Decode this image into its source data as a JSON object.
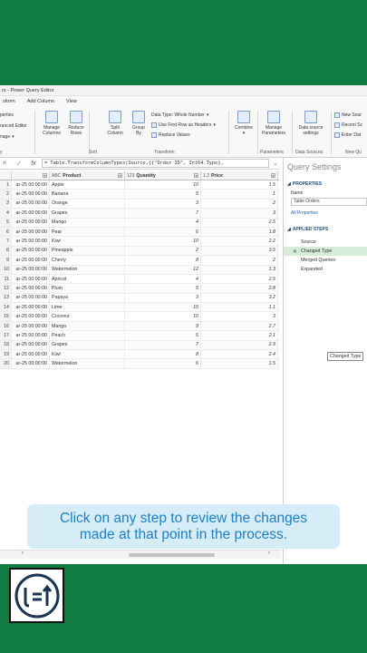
{
  "window": {
    "title": "rs - Power Query Editor"
  },
  "tabs": [
    "sform",
    "Add Column",
    "View"
  ],
  "ribbon": {
    "left_items": [
      "perties",
      "ranced Editor",
      "nage"
    ],
    "manage_columns": [
      "Manage",
      "Columns"
    ],
    "reduce_rows": [
      "Reduce",
      "Rows"
    ],
    "split_column": [
      "Split",
      "Column"
    ],
    "group_by": [
      "Group",
      "By"
    ],
    "data_type": "Data Type: Whole Number",
    "first_row_headers": "Use First Row as Headers",
    "replace_values": "Replace Values",
    "combine": "Combine",
    "manage_parameters": [
      "Manage",
      "Parameters"
    ],
    "data_source_settings": [
      "Data source",
      "settings"
    ],
    "new_source": "New Sour",
    "recent_sources": "Recent Sc",
    "enter_data": "Enter Dat",
    "groups": {
      "sort": "Sort",
      "transform": "Transform",
      "parameters": "Parameters",
      "data_sources": "Data Sources",
      "new_query": "New Qu",
      "left": "y"
    }
  },
  "formula": {
    "text": "= Table.TransformColumnTypes(Source,{{\"Order ID\", Int64.Type},"
  },
  "columns": {
    "product": {
      "type_icon": "ABC",
      "name": "Product"
    },
    "quantity": {
      "type_icon": "123",
      "name": "Quantity"
    },
    "price": {
      "type_icon": "1.2",
      "name": "Price"
    }
  },
  "rows": [
    {
      "n": "1",
      "date": "ar-25 00:00:00",
      "product": "Apple",
      "qty": "10",
      "price": "1.5"
    },
    {
      "n": "2",
      "date": "ar-25 00:00:00",
      "product": "Banana",
      "qty": "5",
      "price": "1"
    },
    {
      "n": "3",
      "date": "ar-25 00:00:00",
      "product": "Orange",
      "qty": "3",
      "price": "2"
    },
    {
      "n": "4",
      "date": "ar-25 00:00:00",
      "product": "Grapes",
      "qty": "7",
      "price": "3"
    },
    {
      "n": "5",
      "date": "ar-25 00:00:00",
      "product": "Mango",
      "qty": "4",
      "price": "2.5"
    },
    {
      "n": "6",
      "date": "ar-25 00:00:00",
      "product": "Pear",
      "qty": "6",
      "price": "1.8"
    },
    {
      "n": "7",
      "date": "ar-25 00:00:00",
      "product": "Kiwi",
      "qty": "10",
      "price": "2.2"
    },
    {
      "n": "8",
      "date": "ar-25 00:00:00",
      "product": "Pineapple",
      "qty": "2",
      "price": "3.5"
    },
    {
      "n": "9",
      "date": "ar-25 00:00:00",
      "product": "Cherry",
      "qty": "8",
      "price": "2"
    },
    {
      "n": "10",
      "date": "ar-25 00:00:00",
      "product": "Watermelon",
      "qty": "12",
      "price": "1.3"
    },
    {
      "n": "11",
      "date": "ar-25 00:00:00",
      "product": "Apricot",
      "qty": "4",
      "price": "2.5"
    },
    {
      "n": "12",
      "date": "ar-25 00:00:00",
      "product": "Plum",
      "qty": "5",
      "price": "2.8"
    },
    {
      "n": "13",
      "date": "ar-25 00:00:00",
      "product": "Papaya",
      "qty": "3",
      "price": "3.2"
    },
    {
      "n": "14",
      "date": "ar-25 00:00:00",
      "product": "Lime",
      "qty": "15",
      "price": "1.1"
    },
    {
      "n": "15",
      "date": "ar-25 00:00:00",
      "product": "Coconut",
      "qty": "10",
      "price": "3"
    },
    {
      "n": "16",
      "date": "ar-25 00:00:00",
      "product": "Mango",
      "qty": "9",
      "price": "2.7"
    },
    {
      "n": "17",
      "date": "ar-25 00:00:00",
      "product": "Peach",
      "qty": "5",
      "price": "2.1"
    },
    {
      "n": "18",
      "date": "ar-25 00:00:00",
      "product": "Grapes",
      "qty": "7",
      "price": "2.9"
    },
    {
      "n": "19",
      "date": "ar-25 00:00:00",
      "product": "Kiwi",
      "qty": "8",
      "price": "2.4"
    },
    {
      "n": "20",
      "date": "ar-25 00:00:00",
      "product": "Watermelon",
      "qty": "6",
      "price": "1.5"
    }
  ],
  "query_settings": {
    "title": "Query Settings",
    "properties_header": "PROPERTIES",
    "name_label": "Name",
    "name_value": "Table Orders",
    "all_properties": "All Properties",
    "applied_steps_header": "APPLIED STEPS",
    "steps": [
      "Source",
      "Changed Type",
      "Merged Queries",
      "Expanded"
    ],
    "tooltip": "Changed Type"
  },
  "caption": {
    "line1": "Click on any step to review the changes",
    "line2": "made at that point in the process."
  },
  "colors": {
    "background": "#107c41",
    "caption_bg": "#d6ecf7",
    "caption_text": "#1e80c4",
    "selected_step": "#d5ecd9"
  },
  "icons": [
    "close-icon",
    "check-icon",
    "fx-icon",
    "chevron-down-icon",
    "type-abc-icon",
    "type-123-icon",
    "type-decimal-icon",
    "step-delete-icon",
    "logo"
  ]
}
